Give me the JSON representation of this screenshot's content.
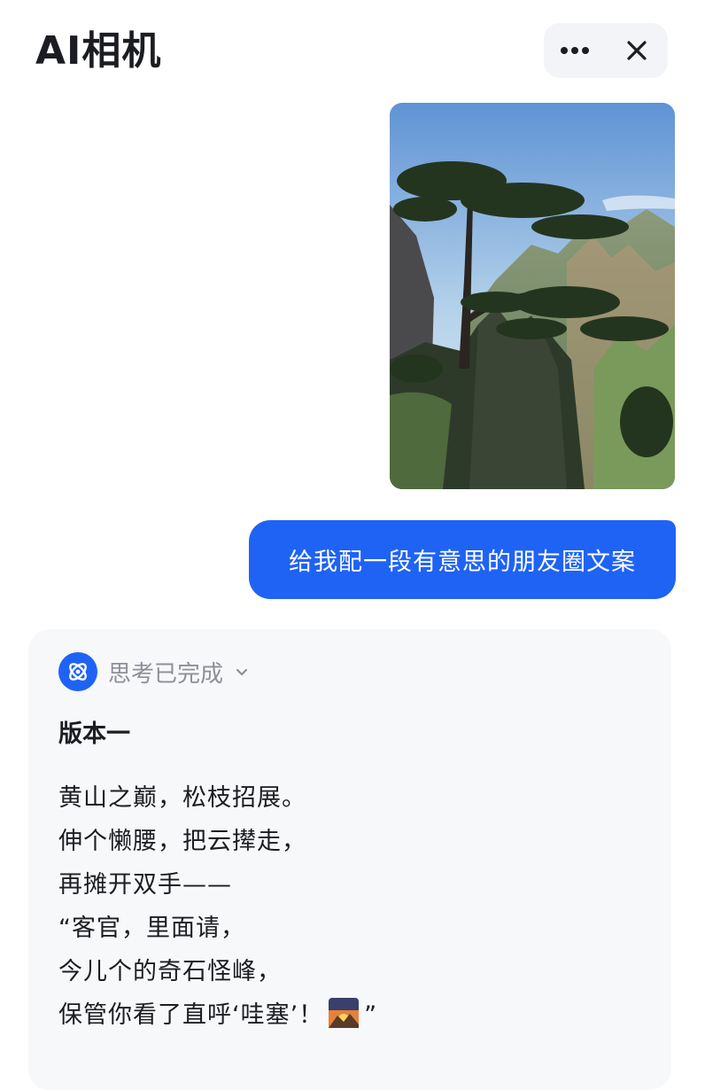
{
  "app": {
    "title": "AI相机"
  },
  "header": {
    "more_icon": "more-dots-icon",
    "close_icon": "close-icon"
  },
  "chat": {
    "user_message": "给我配一段有意思的朋友圈文案",
    "ai": {
      "thinking_status": "思考已完成",
      "version_title": "版本一",
      "poem_lines": [
        "黄山之巅，松枝招展。",
        "伸个懒腰，把云撵走，",
        "再摊开双手——",
        "“客官，里面请，",
        "今儿个的奇石怪峰，",
        "保管你看了直呼‘哇塞’！"
      ],
      "poem_closing_quote": "”",
      "emoji": "sunrise-emoji"
    }
  },
  "colors": {
    "accent": "#1f63f5",
    "card_bg": "#f7f8fa",
    "muted_text": "#8e9097"
  }
}
